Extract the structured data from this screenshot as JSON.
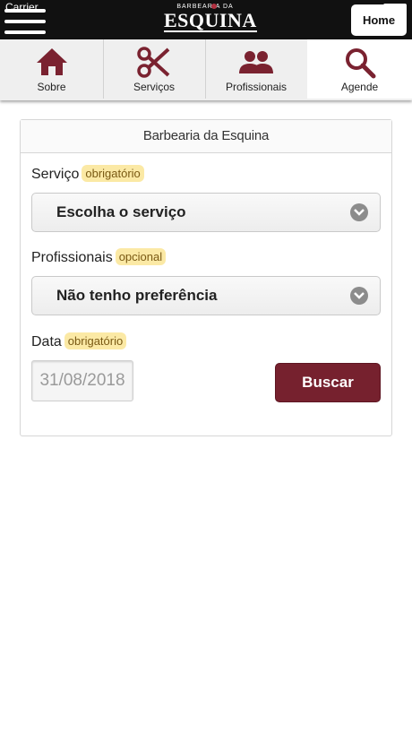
{
  "status_bar": {
    "carrier": "Carrier"
  },
  "header": {
    "logo_top": "BARBEARIA DA",
    "logo_main": "ESQUINA",
    "home_label": "Home"
  },
  "nav": {
    "items": [
      {
        "label": "Sobre",
        "icon": "home-icon"
      },
      {
        "label": "Serviços",
        "icon": "scissors-icon"
      },
      {
        "label": "Profissionais",
        "icon": "people-icon"
      },
      {
        "label": "Agende",
        "icon": "search-icon"
      }
    ],
    "active_index": 3
  },
  "form": {
    "title": "Barbearia da Esquina",
    "service_label": "Serviço",
    "service_badge": "obrigatório",
    "service_value": "Escolha o serviço",
    "professional_label": "Profissionais",
    "professional_badge": "opcional",
    "professional_value": "Não tenho preferência",
    "date_label": "Data",
    "date_badge": "obrigatório",
    "date_value": "31/08/2018",
    "search_button": "Buscar"
  },
  "colors": {
    "brand": "#76212e",
    "badge_bg": "#fbe9a5",
    "topbar": "#111111"
  }
}
